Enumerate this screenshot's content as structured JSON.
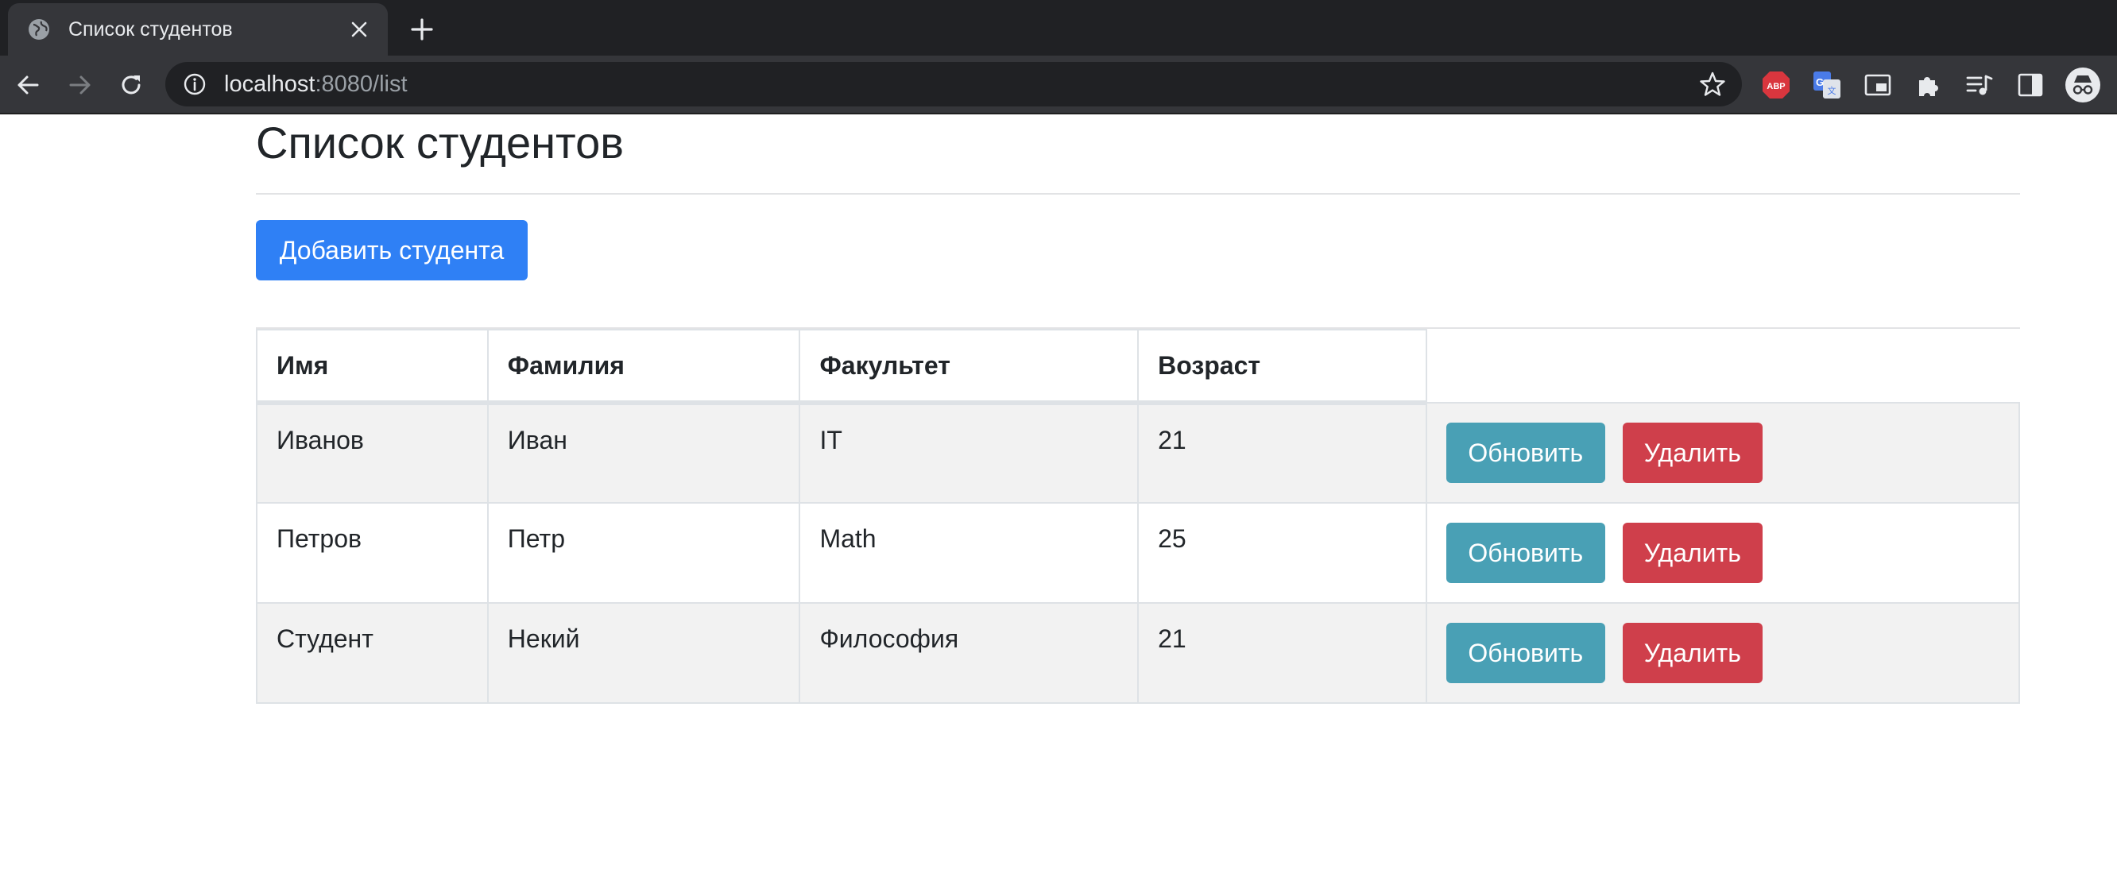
{
  "browser": {
    "tab_title": "Список студентов",
    "url_host": "localhost",
    "url_path": ":8080/list",
    "extensions": [
      "abp-icon",
      "google-translate-icon",
      "picture-in-picture-icon",
      "puzzle-icon",
      "media-queue-icon",
      "side-panel-icon",
      "incognito-icon"
    ]
  },
  "page": {
    "title": "Список студентов",
    "add_button": "Добавить студента"
  },
  "table": {
    "headers": [
      "Имя",
      "Фамилия",
      "Факультет",
      "Возраст"
    ],
    "rows": [
      {
        "first": "Иванов",
        "last": "Иван",
        "faculty": "IT",
        "age": "21"
      },
      {
        "first": "Петров",
        "last": "Петр",
        "faculty": "Math",
        "age": "25"
      },
      {
        "first": "Студент",
        "last": "Некий",
        "faculty": "Философия",
        "age": "21"
      }
    ],
    "update_label": "Обновить",
    "delete_label": "Удалить"
  },
  "colors": {
    "primary": "#2f80f5",
    "info": "#49a0b5",
    "danger": "#cf3f4b",
    "stripe": "#f2f2f2"
  }
}
